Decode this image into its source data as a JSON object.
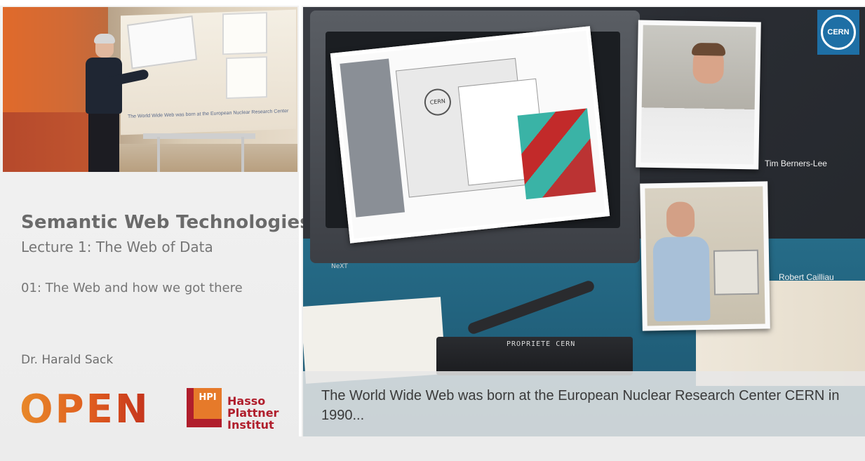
{
  "sidebar": {
    "course_title": "Semantic Web Technologies",
    "lecture_title": "Lecture 1: The Web of Data",
    "subtitle": "01: The Web and how we got there",
    "speaker": "Dr. Harald Sack"
  },
  "video": {
    "projected_caption": "The World Wide Web was born at the European Nuclear Research Center"
  },
  "logo": {
    "open_text": "OPEN",
    "hpi_badge": "HPI",
    "institute_lines": [
      "Hasso",
      "Plattner",
      "Institut"
    ]
  },
  "slide": {
    "caption": "The World Wide Web was born at the European Nuclear Research Center CERN in 1990...",
    "photo_labels": {
      "top": "Tim Berners-Lee",
      "bottom": "Robert Cailliau"
    },
    "cern_logo_text": "CERN",
    "keyboard_brand": "PROPRIETE CERN",
    "monitor_label": "NeXT",
    "screen_logo_text": "CERN"
  },
  "colors": {
    "accent_orange": "#e67a2a",
    "hpi_red": "#b01e2c",
    "cern_blue": "#1e6fa5"
  }
}
